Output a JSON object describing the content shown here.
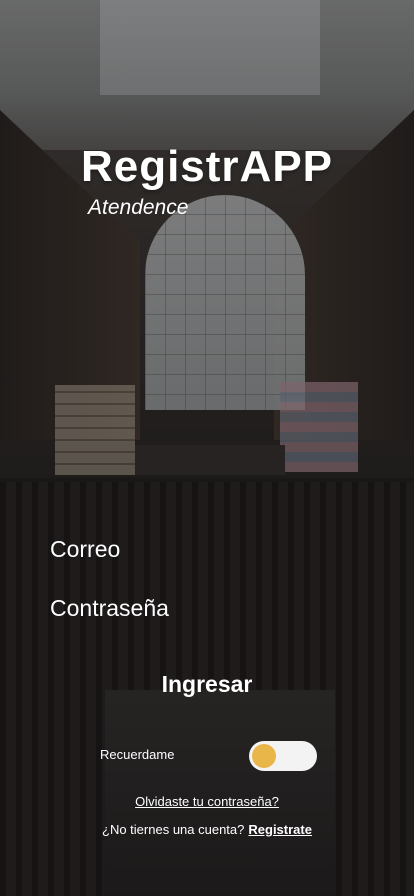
{
  "app": {
    "title": "RegistrAPP",
    "subtitle": "Atendence"
  },
  "form": {
    "email_label": "Correo",
    "password_label": "Contraseña",
    "submit_label": "Ingresar",
    "remember_label": "Recuerdame",
    "remember_enabled": false
  },
  "links": {
    "forgot_password": "Olvidaste tu contraseña?",
    "no_account_prompt": "¿No tiernes una cuenta?",
    "register": "Registrate"
  },
  "colors": {
    "toggle_track": "#f3f3f3",
    "toggle_knob": "#e9b64a",
    "text": "#ffffff"
  }
}
